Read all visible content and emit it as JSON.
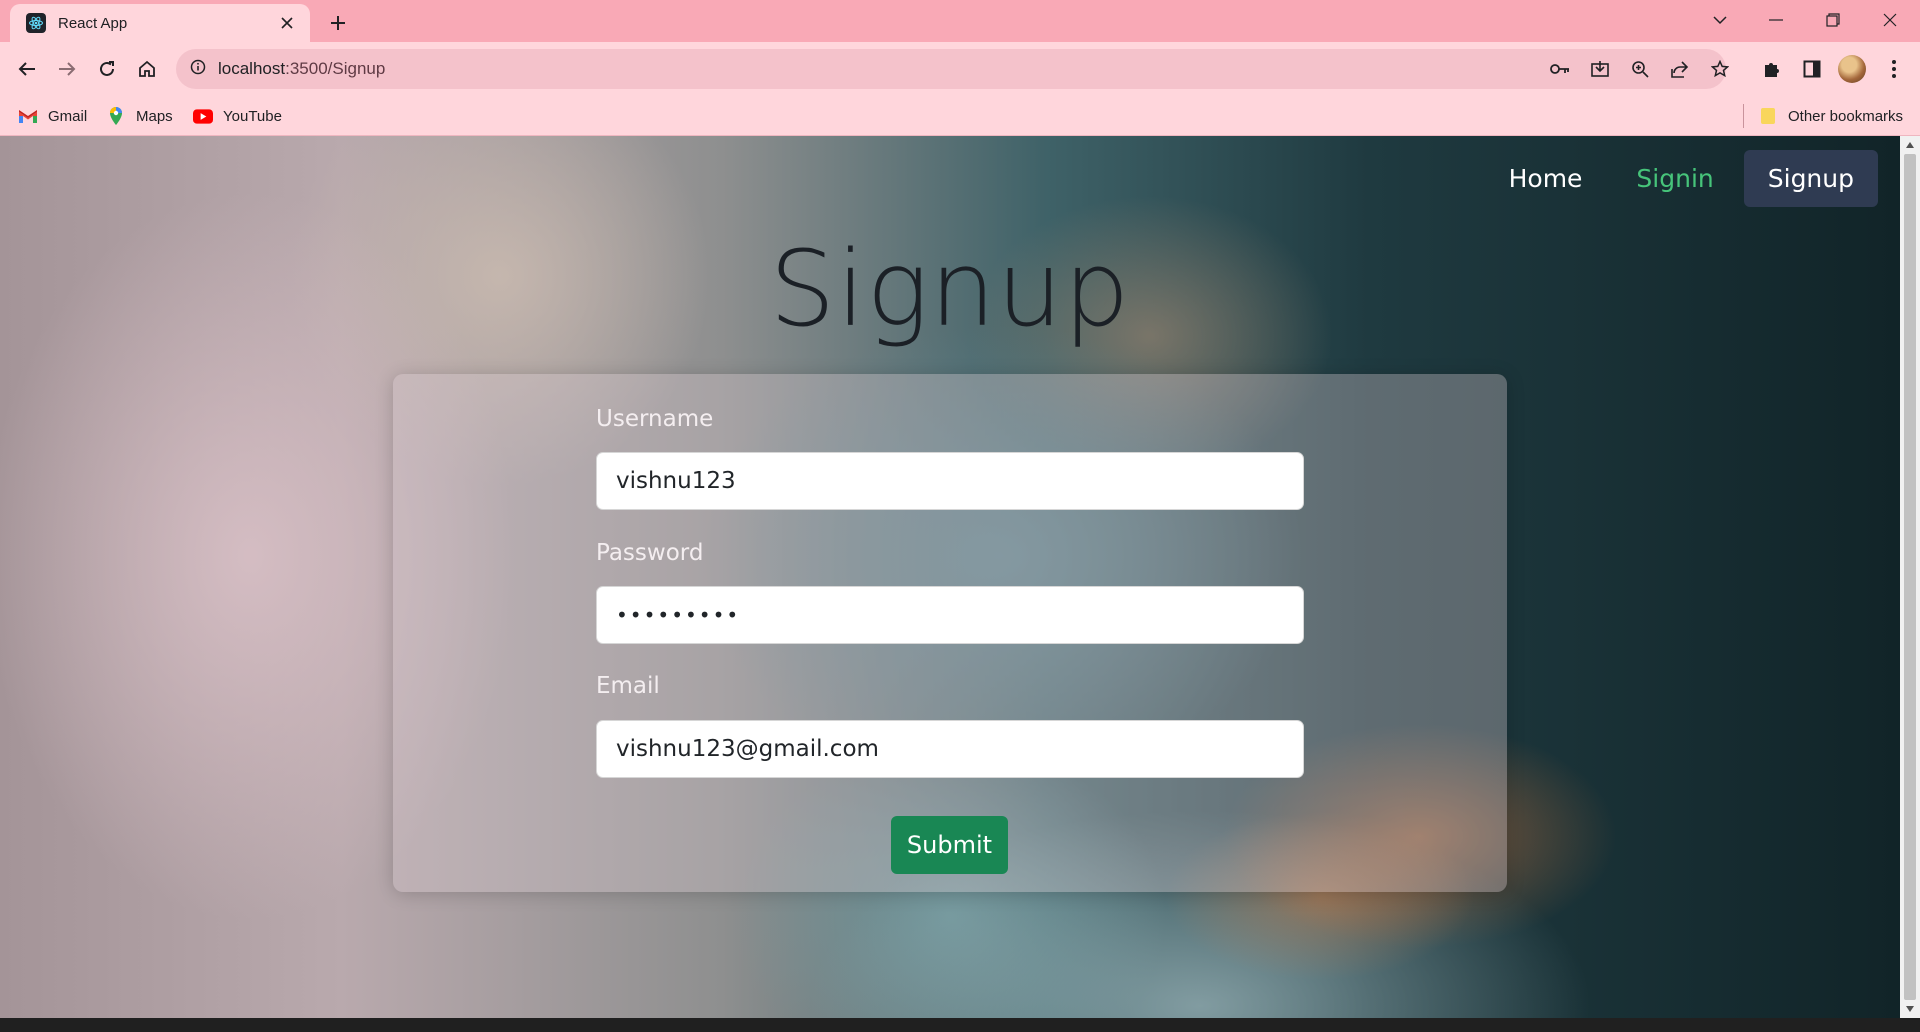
{
  "browser": {
    "tab_title": "React App",
    "url_host": "localhost",
    "url_path": ":3500/Signup",
    "bookmarks": [
      {
        "label": "Gmail",
        "icon": "gmail-icon"
      },
      {
        "label": "Maps",
        "icon": "maps-pin-icon"
      },
      {
        "label": "YouTube",
        "icon": "youtube-icon"
      }
    ],
    "other_bookmarks": "Other bookmarks"
  },
  "nav": {
    "home": "Home",
    "signin": "Signin",
    "signup": "Signup"
  },
  "page": {
    "title": "Signup"
  },
  "form": {
    "username_label": "Username",
    "username_value": "vishnu123",
    "password_label": "Password",
    "password_value": "•••••••••",
    "email_label": "Email",
    "email_value": "vishnu123@gmail.com",
    "submit_label": "Submit"
  },
  "colors": {
    "chrome_frame": "#f9a9b6",
    "chrome_surface": "#ffd6dc",
    "nav_active_green": "#46c47a",
    "nav_current_bg": "#2f3b52",
    "submit_bg": "#198754"
  }
}
